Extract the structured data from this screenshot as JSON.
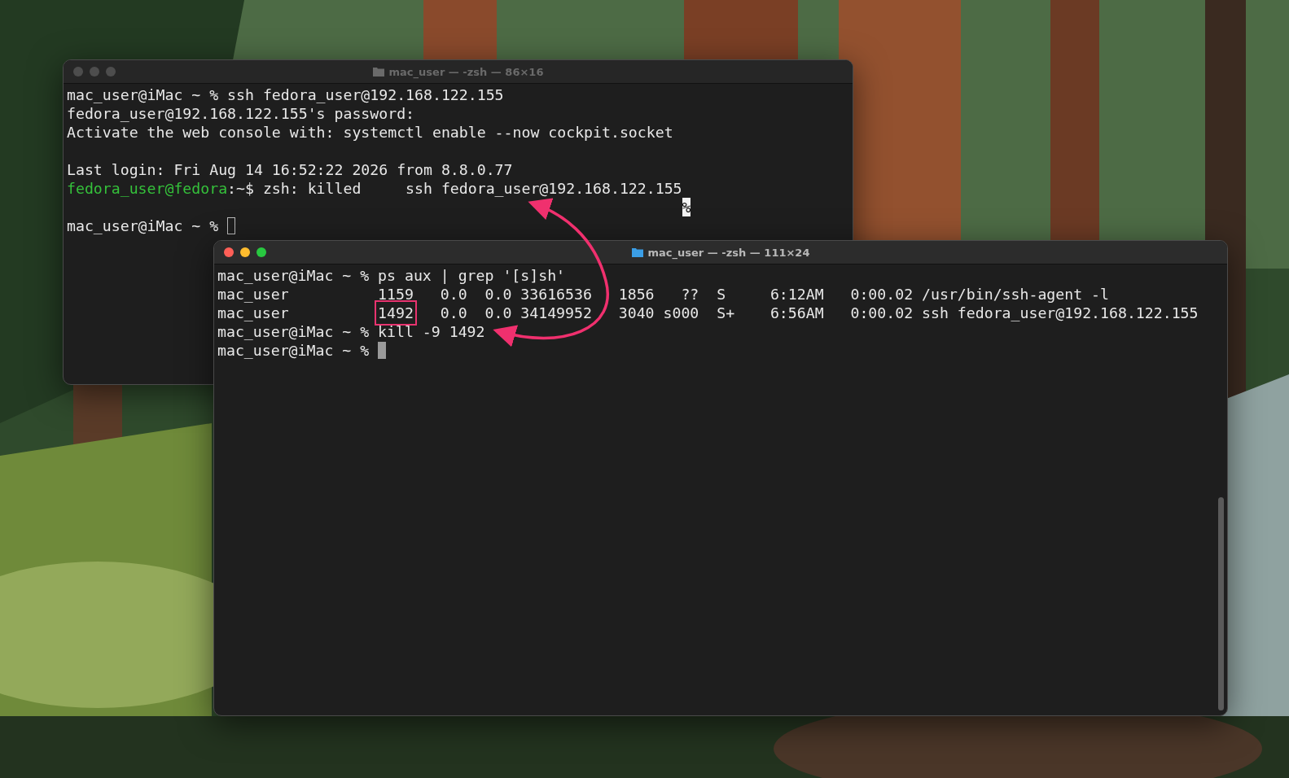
{
  "windows": [
    {
      "title": "mac_user — -zsh — 86×16",
      "active": false,
      "cursor_filled": false,
      "lines": [
        {
          "parts": [
            {
              "text": "mac_user@iMac ~ % ssh fedora_user@192.168.122.155"
            }
          ]
        },
        {
          "parts": [
            {
              "text": "fedora_user@192.168.122.155's password:"
            }
          ]
        },
        {
          "parts": [
            {
              "text": "Activate the web console with: systemctl enable --now cockpit.socket"
            }
          ]
        },
        {
          "gap_before": true,
          "parts": [
            {
              "text": "Last login: Fri Aug 14 16:52:22 2026 from 8.8.0.77"
            }
          ]
        },
        {
          "parts": [
            {
              "text": "fedora_user@fedora",
              "color": "#35c13b"
            },
            {
              "text": ":~$ zsh: killed     ssh fedora_user@192.168.122.155"
            }
          ]
        },
        {
          "parts": [
            {
              "text": "%",
              "inverse": true
            }
          ],
          "cursor": false
        },
        {
          "parts": [
            {
              "text": "mac_user@iMac ~ % "
            }
          ],
          "cursor": true
        }
      ]
    },
    {
      "title": "mac_user — -zsh — 111×24",
      "active": true,
      "cursor_filled": true,
      "lines": [
        {
          "parts": [
            {
              "text": "mac_user@iMac ~ % ps aux | grep '[s]sh'"
            }
          ]
        },
        {
          "parts": [
            {
              "text": "mac_user          1159   0.0  0.0 33616536   1856   ??  S     6:12AM   0:00.02 /usr/bin/ssh-agent -l"
            }
          ]
        },
        {
          "parts": [
            {
              "text": "mac_user          "
            },
            {
              "text": "1492",
              "boxed": true
            },
            {
              "text": "   0.0  0.0 34149952   3040 s000  S+    6:56AM   0:00.02 ssh fedora_user@192.168.122.155"
            }
          ]
        },
        {
          "parts": [
            {
              "text": "mac_user@iMac ~ % kill -9 1492"
            }
          ]
        },
        {
          "parts": [
            {
              "text": "mac_user@iMac ~ % "
            }
          ],
          "cursor": true
        }
      ]
    }
  ]
}
